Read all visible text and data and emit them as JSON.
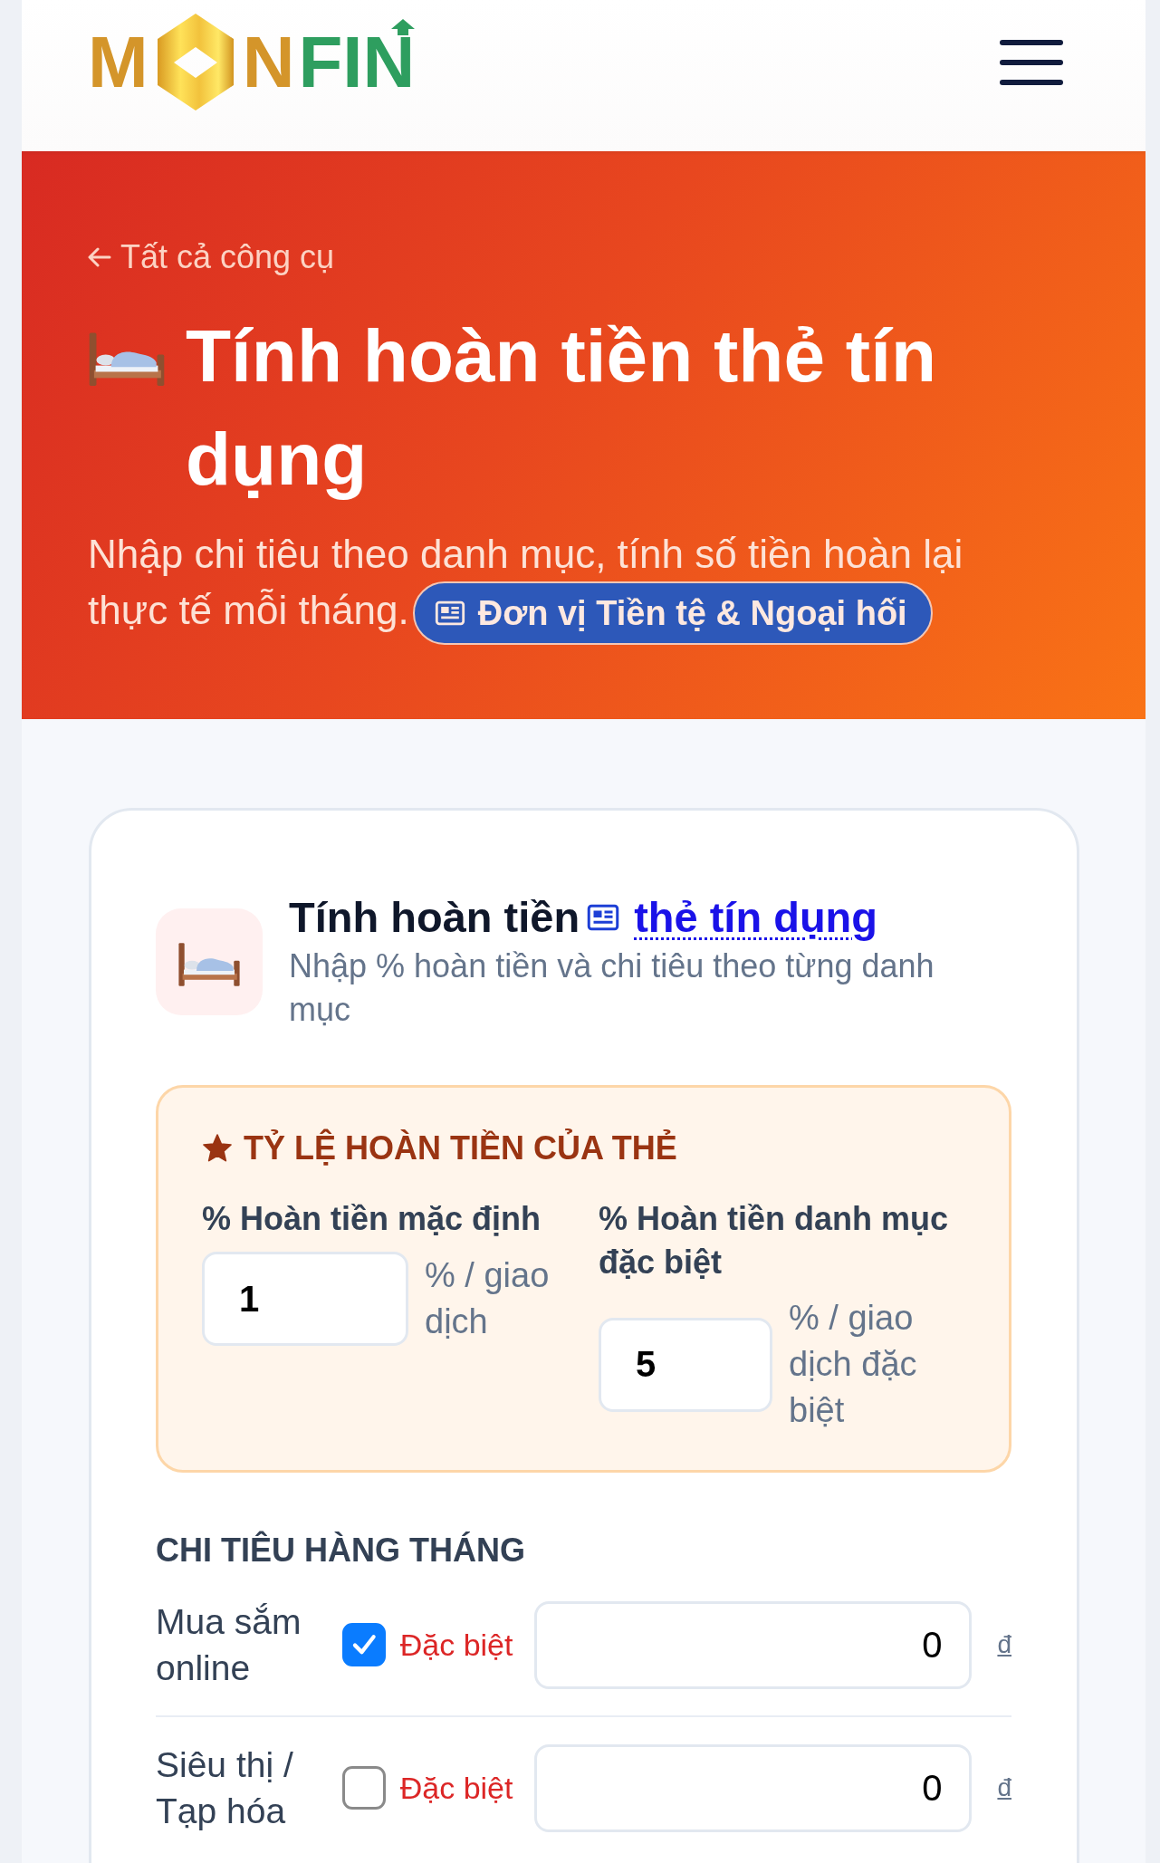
{
  "header": {
    "logo": {
      "parts": [
        "M",
        "N",
        "FIN"
      ]
    }
  },
  "hero": {
    "back_link": "Tất cả công cụ",
    "title": "Tính hoàn tiền thẻ tín dụng",
    "subtitle": "Nhập chi tiêu theo danh mục, tính số tiền hoàn lại thực tế mỗi tháng.",
    "category_link": "Đơn vị Tiền tệ & Ngoại hối"
  },
  "card": {
    "title": "Tính hoàn tiền",
    "title_link": "thẻ tín dụng",
    "subtitle": "Nhập % hoàn tiền và chi tiêu theo từng danh mục",
    "rates": {
      "heading": "TỶ LỆ HOÀN TIỀN CỦA THẺ",
      "fields": [
        {
          "label": "% Hoàn tiền mặc định",
          "value": "1",
          "unit": "% / giao dịch"
        },
        {
          "label": "% Hoàn tiền danh mục đặc biệt",
          "value": "5",
          "unit": "% / giao dịch đặc biệt"
        }
      ]
    },
    "spending": {
      "heading": "CHI TIÊU HÀNG THÁNG",
      "rows": [
        {
          "category": "Mua sắm online",
          "checked": true,
          "special_label": "Đặc biệt",
          "amount": "0",
          "currency": "đ"
        },
        {
          "category": "Siêu thị / Tạp hóa",
          "checked": false,
          "special_label": "Đặc biệt",
          "amount": "0",
          "currency": "đ"
        }
      ]
    }
  }
}
